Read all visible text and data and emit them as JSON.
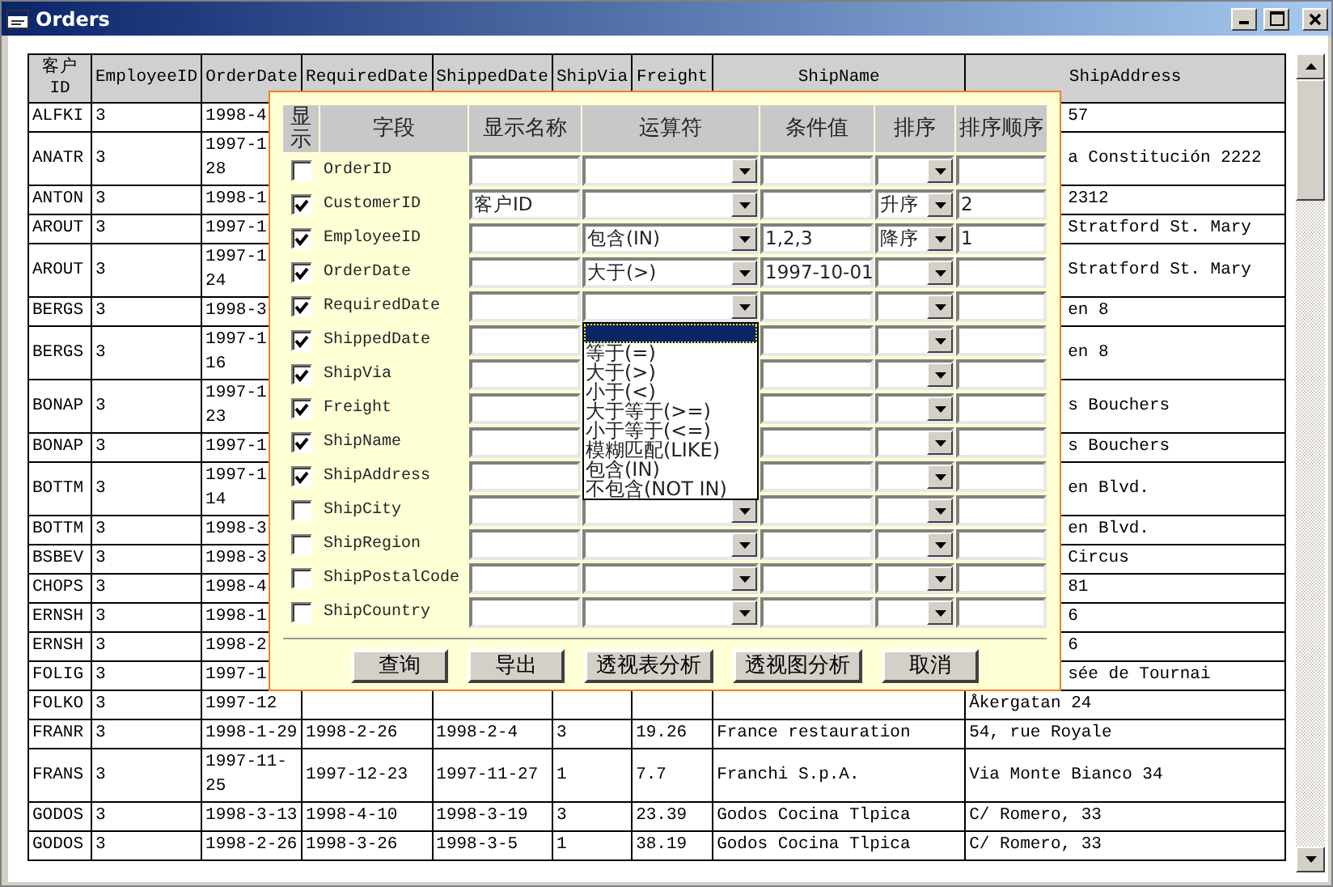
{
  "window": {
    "title": "Orders"
  },
  "table": {
    "columns": [
      "客户\nID",
      "EmployeeID",
      "OrderDate",
      "RequiredDate",
      "ShippedDate",
      "ShipVia",
      "Freight",
      "ShipName",
      "ShipAddress"
    ],
    "rows": [
      {
        "customer_id": "ALFKI",
        "employee_id": "3",
        "order_date": "1998-4",
        "ship_address": "57"
      },
      {
        "customer_id": "ANATR",
        "employee_id": "3",
        "order_date": "1997-1\n28",
        "ship_address": "a Constitución 2222"
      },
      {
        "customer_id": "ANTON",
        "employee_id": "3",
        "order_date": "1998-1",
        "ship_address": "2312"
      },
      {
        "customer_id": "AROUT",
        "employee_id": "3",
        "order_date": "1997-1",
        "ship_address": "Stratford St. Mary"
      },
      {
        "customer_id": "AROUT",
        "employee_id": "3",
        "order_date": "1997-1\n24",
        "ship_address": "Stratford St. Mary"
      },
      {
        "customer_id": "BERGS",
        "employee_id": "3",
        "order_date": "1998-3",
        "ship_address": "en 8"
      },
      {
        "customer_id": "BERGS",
        "employee_id": "3",
        "order_date": "1997-1\n16",
        "ship_address": "en 8"
      },
      {
        "customer_id": "BONAP",
        "employee_id": "3",
        "order_date": "1997-1\n23",
        "ship_address": "s Bouchers"
      },
      {
        "customer_id": "BONAP",
        "employee_id": "3",
        "order_date": "1997-1",
        "ship_address": "s Bouchers"
      },
      {
        "customer_id": "BOTTM",
        "employee_id": "3",
        "order_date": "1997-1\n14",
        "ship_address": "en Blvd."
      },
      {
        "customer_id": "BOTTM",
        "employee_id": "3",
        "order_date": "1998-3",
        "ship_address": "en Blvd."
      },
      {
        "customer_id": "BSBEV",
        "employee_id": "3",
        "order_date": "1998-3",
        "ship_address": "Circus"
      },
      {
        "customer_id": "CHOPS",
        "employee_id": "3",
        "order_date": "1998-4",
        "ship_address": "81"
      },
      {
        "customer_id": "ERNSH",
        "employee_id": "3",
        "order_date": "1998-1",
        "ship_address": "6"
      },
      {
        "customer_id": "ERNSH",
        "employee_id": "3",
        "order_date": "1998-2",
        "ship_address": "6"
      },
      {
        "customer_id": "FOLIG",
        "employee_id": "3",
        "order_date": "1997-1",
        "ship_address": "sée de Tournai"
      },
      {
        "customer_id": "FOLKO",
        "employee_id": "3",
        "order_date": "1997-12",
        "ship_address": "Åkergatan 24"
      },
      {
        "customer_id": "FRANR",
        "employee_id": "3",
        "order_date": "1998-1-29",
        "required_date": "1998-2-26",
        "shipped_date": "1998-2-4",
        "ship_via": "3",
        "freight": "19.26",
        "ship_name": "France restauration",
        "ship_address": "54, rue Royale"
      },
      {
        "customer_id": "FRANS",
        "employee_id": "3",
        "order_date": "1997-11-\n25",
        "required_date": "1997-12-23",
        "shipped_date": "1997-11-27",
        "ship_via": "1",
        "freight": "7.7",
        "ship_name": "Franchi S.p.A.",
        "ship_address": "Via Monte Bianco 34"
      },
      {
        "customer_id": "GODOS",
        "employee_id": "3",
        "order_date": "1998-3-13",
        "required_date": "1998-4-10",
        "shipped_date": "1998-3-19",
        "ship_via": "3",
        "freight": "23.39",
        "ship_name": "Godos Cocina Tlpica",
        "ship_address": "C/ Romero, 33"
      },
      {
        "customer_id": "GODOS",
        "employee_id": "3",
        "order_date": "1998-2-26",
        "required_date": "1998-3-26",
        "shipped_date": "1998-3-5",
        "ship_via": "1",
        "freight": "38.19",
        "ship_name": "Godos Cocina Tlpica",
        "ship_address": "C/ Romero, 33"
      }
    ]
  },
  "dialog": {
    "header": [
      "显示",
      "字段",
      "显示名称",
      "运算符",
      "条件值",
      "排序",
      "排序顺序"
    ],
    "fields": [
      {
        "show": false,
        "field": "OrderID",
        "operator_expanded": false
      },
      {
        "show": true,
        "field": "CustomerID",
        "display_name": "客户ID",
        "sort": "升序",
        "sort_order": "2",
        "operator_expanded": false
      },
      {
        "show": true,
        "field": "EmployeeID",
        "operator": "包含(IN)",
        "condition": "1,2,3",
        "sort": "降序",
        "sort_order": "1",
        "operator_expanded": false
      },
      {
        "show": true,
        "field": "OrderDate",
        "operator": "大于(>)",
        "condition": "1997-10-01",
        "operator_expanded": false
      },
      {
        "show": true,
        "field": "RequiredDate",
        "operator_expanded": true
      },
      {
        "show": true,
        "field": "ShippedDate",
        "operator_expanded": false
      },
      {
        "show": true,
        "field": "ShipVia",
        "operator_expanded": false
      },
      {
        "show": true,
        "field": "Freight",
        "operator_expanded": false
      },
      {
        "show": true,
        "field": "ShipName",
        "operator_expanded": false
      },
      {
        "show": true,
        "field": "ShipAddress",
        "operator_expanded": false
      },
      {
        "show": false,
        "field": "ShipCity",
        "operator_expanded": false
      },
      {
        "show": false,
        "field": "ShipRegion",
        "operator_expanded": false
      },
      {
        "show": false,
        "field": "ShipPostalCode",
        "operator_expanded": false
      },
      {
        "show": false,
        "field": "ShipCountry",
        "operator_expanded": false
      }
    ],
    "operator_dropdown": {
      "blank_selected": true,
      "options": [
        {
          "label": "等于(=)",
          "selected": false
        },
        {
          "label": "大于(>)",
          "selected": false
        },
        {
          "label": "小于(<)",
          "selected": false
        },
        {
          "label": "大于等于(>=)",
          "selected": false
        },
        {
          "label": "小于等于(<=)",
          "selected": false
        },
        {
          "label": "模糊匹配(LIKE)",
          "selected": false
        },
        {
          "label": "包含(IN)",
          "selected": false
        },
        {
          "label": "不包含(NOT IN)",
          "selected": false
        }
      ]
    },
    "buttons": [
      "查询",
      "导出",
      "透视表分析",
      "透视图分析",
      "取消"
    ]
  }
}
